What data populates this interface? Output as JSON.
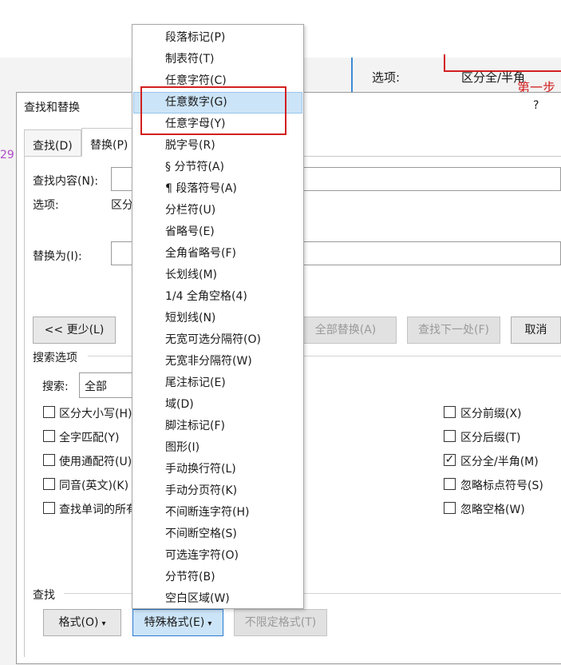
{
  "background": {
    "options_label": "选项:",
    "options_value": "区分全/半角",
    "step_label": "第一步",
    "line_number": "29"
  },
  "dialog": {
    "title": "查找和替换",
    "help": "?",
    "tabs": [
      "查找(D)",
      "替换(P)"
    ],
    "find_label": "查找内容(N):",
    "find_value": "",
    "options_label": "选项:",
    "options_value": "区分全/半角",
    "replace_label": "替换为(I):",
    "replace_value": "",
    "less_button": "<< 更少(L)",
    "replace_all_button": "全部替换(A)",
    "find_next_button": "查找下一处(F)",
    "cancel_button": "取消",
    "search_options_label": "搜索选项",
    "search_label": "搜索:",
    "search_value": "全部",
    "left_checks": [
      {
        "label": "区分大小写(H)",
        "checked": false
      },
      {
        "label": "全字匹配(Y)",
        "checked": false
      },
      {
        "label": "使用通配符(U)",
        "checked": false
      },
      {
        "label": "同音(英文)(K)",
        "checked": false
      },
      {
        "label": "查找单词的所有形式(英文)(W)",
        "checked": false
      }
    ],
    "right_checks": [
      {
        "label": "区分前缀(X)",
        "checked": false
      },
      {
        "label": "区分后缀(T)",
        "checked": false
      },
      {
        "label": "区分全/半角(M)",
        "checked": true
      },
      {
        "label": "忽略标点符号(S)",
        "checked": false
      },
      {
        "label": "忽略空格(W)",
        "checked": false
      }
    ],
    "find_section_label": "查找",
    "format_button": "格式(O)",
    "special_button": "特殊格式(E)",
    "no_format_button": "不限定格式(T)",
    "check_mark": "✓",
    "dropdown_arrow": "▾"
  },
  "menu": {
    "items": [
      "段落标记(P)",
      "制表符(T)",
      "任意字符(C)",
      "任意数字(G)",
      "任意字母(Y)",
      "脱字号(R)",
      "§ 分节符(A)",
      "¶ 段落符号(A)",
      "分栏符(U)",
      "省略号(E)",
      "全角省略号(F)",
      "长划线(M)",
      "1/4 全角空格(4)",
      "短划线(N)",
      "无宽可选分隔符(O)",
      "无宽非分隔符(W)",
      "尾注标记(E)",
      "域(D)",
      "脚注标记(F)",
      "图形(I)",
      "手动换行符(L)",
      "手动分页符(K)",
      "不间断连字符(H)",
      "不间断空格(S)",
      "可选连字符(O)",
      "分节符(B)",
      "空白区域(W)"
    ],
    "highlighted_index": 3
  },
  "colors": {
    "accent": "#cce4f7",
    "annotation_red": "#d21f1f"
  }
}
